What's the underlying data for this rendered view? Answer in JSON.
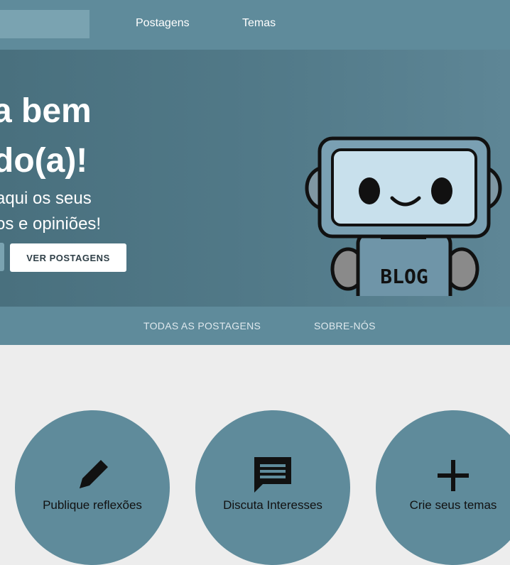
{
  "nav": {
    "links": [
      "Postagens",
      "Temas"
    ]
  },
  "hero": {
    "title_line1": "a bem",
    "title_line2": "do(a)!",
    "sub_line1": "aqui os seus",
    "sub_line2": "os e opiniões!",
    "button_label": "VER POSTAGENS",
    "robot_text": "BLOG"
  },
  "subnav": {
    "links": [
      "TODAS AS POSTAGENS",
      "SOBRE-NÓS"
    ]
  },
  "features": [
    {
      "label": "Publique reflexões",
      "icon": "pencil-icon"
    },
    {
      "label": "Discuta Interesses",
      "icon": "chat-icon"
    },
    {
      "label": "Crie seus temas",
      "icon": "plus-icon"
    }
  ],
  "colors": {
    "primary": "#5f8b9b",
    "hero_dark": "#49707e",
    "background": "#ededed"
  }
}
